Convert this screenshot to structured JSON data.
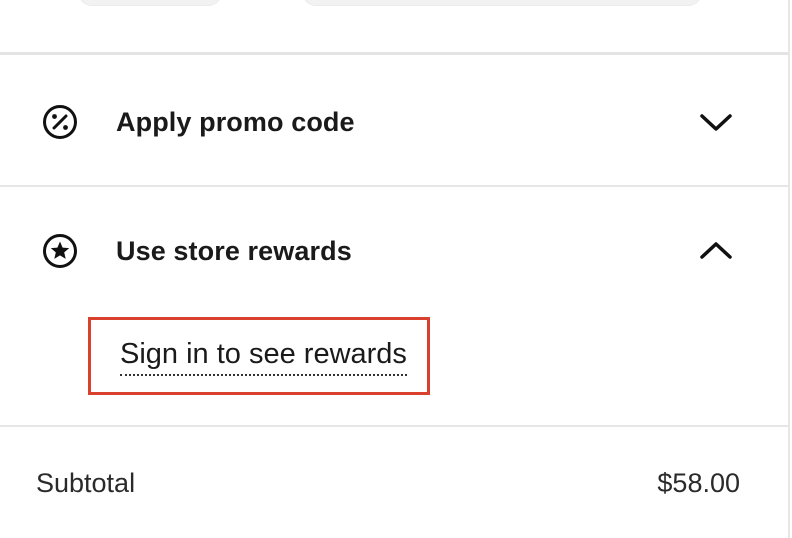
{
  "promo": {
    "label": "Apply promo code",
    "icon": "percent-circle-icon",
    "state": "collapsed"
  },
  "rewards": {
    "label": "Use store rewards",
    "icon": "star-circle-icon",
    "state": "expanded",
    "signin_link": "Sign in to see rewards"
  },
  "summary": {
    "subtotal_label": "Subtotal",
    "subtotal_value": "$58.00"
  },
  "colors": {
    "highlight_border": "#d9412e",
    "divider": "#e6e6e6",
    "text": "#1a1a1a"
  }
}
